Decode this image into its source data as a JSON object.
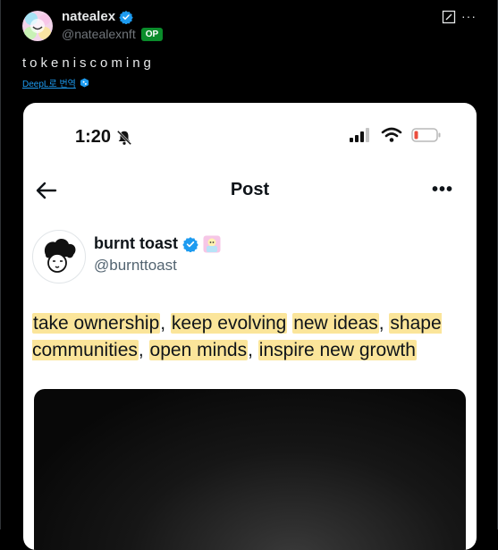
{
  "author": {
    "name": "natealex",
    "handle": "@natealexnft",
    "badge": "OP"
  },
  "tweet": {
    "text": "tokeniscoming",
    "translate_label": "DeepL로 번역"
  },
  "embedded": {
    "status_time": "1:20",
    "nav_title": "Post",
    "author_name": "burnt toast",
    "author_handle": "@burnttoast",
    "post_segments": [
      {
        "t": "take ownership",
        "h": true
      },
      {
        "t": ", ",
        "h": false
      },
      {
        "t": "keep evolving",
        "h": true
      },
      {
        "t": " ",
        "h": false
      },
      {
        "t": "new ideas",
        "h": true
      },
      {
        "t": ", ",
        "h": false
      },
      {
        "t": "shape communities",
        "h": true
      },
      {
        "t": ", ",
        "h": false
      },
      {
        "t": "open minds",
        "h": true
      },
      {
        "t": ", ",
        "h": false
      },
      {
        "t": "inspire new growth",
        "h": true
      }
    ]
  },
  "colors": {
    "accent": "#1d9bf0",
    "op_badge": "#0a8c2b",
    "highlight": "#fbe59a"
  }
}
